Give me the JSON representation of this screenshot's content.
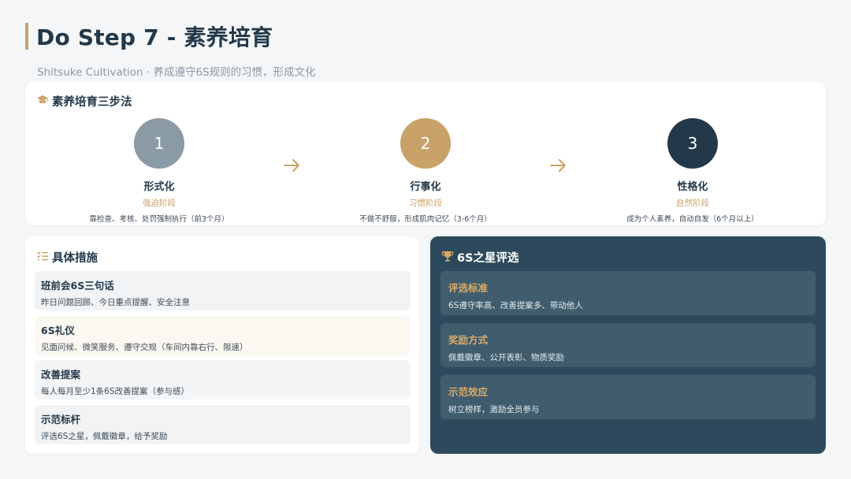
{
  "header": {
    "title": "Do Step 7 - 素养培育",
    "subtitle": "Shitsuke Cultivation · 养成遵守6S规则的习惯，形成文化"
  },
  "steps_section": {
    "heading": "素养培育三步法",
    "icon": "graduation-cap-icon",
    "steps": [
      {
        "number": "1",
        "name": "形式化",
        "phase": "强迫阶段",
        "desc": "靠检查、考核、处罚强制执行（前3个月）",
        "color": "#8a9ba6"
      },
      {
        "number": "2",
        "name": "行事化",
        "phase": "习惯阶段",
        "desc": "不做不舒服，形成肌肉记忆（3-6个月）",
        "color": "#c9a26a"
      },
      {
        "number": "3",
        "name": "性格化",
        "phase": "自然阶段",
        "desc": "成为个人素养，自动自发（6个月以上）",
        "color": "#23394a"
      }
    ]
  },
  "measures_section": {
    "heading": "具体措施",
    "icon": "checklist-icon",
    "items": [
      {
        "title": "班前会6S三句话",
        "desc": "昨日问题回顾、今日重点提醒、安全注意"
      },
      {
        "title": "6S礼仪",
        "desc": "见面问候、微笑服务、遵守交规（车间内靠右行、限速）"
      },
      {
        "title": "改善提案",
        "desc": "每人每月至少1条6S改善提案（参与感）"
      },
      {
        "title": "示范标杆",
        "desc": "评选6S之星，佩戴徽章，给予奖励"
      }
    ]
  },
  "star_section": {
    "heading": "6S之星评选",
    "icon": "trophy-icon",
    "items": [
      {
        "title": "评选标准",
        "desc": "6S遵守率高、改善提案多、带动他人"
      },
      {
        "title": "奖励方式",
        "desc": "佩戴徽章、公开表彰、物质奖励"
      },
      {
        "title": "示范效应",
        "desc": "树立榜样，激励全员参与"
      }
    ]
  },
  "colors": {
    "accent": "#c9a26a",
    "navy": "#23394a",
    "dark_panel": "#2c4a5c"
  }
}
